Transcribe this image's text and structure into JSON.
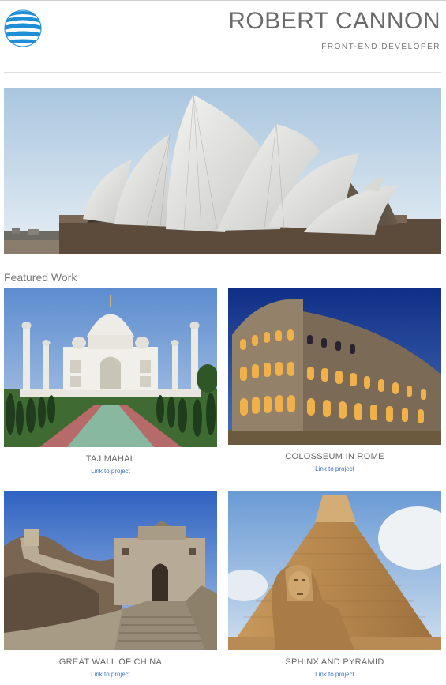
{
  "header": {
    "name": "ROBERT CANNON",
    "role": "FRONT-END DEVELOPER",
    "logo_icon": "globe-logo-icon"
  },
  "hero": {
    "image": "sydney-opera-house"
  },
  "featured": {
    "title": "Featured Work",
    "projects": [
      {
        "title": "TAJ MAHAL",
        "link": "Link to project",
        "image": "taj-mahal"
      },
      {
        "title": "COLOSSEUM IN ROME",
        "link": "Link to project",
        "image": "colosseum"
      },
      {
        "title": "GREAT WALL OF CHINA",
        "link": "Link to project",
        "image": "great-wall"
      },
      {
        "title": "SPHINX AND PYRAMID",
        "link": "Link to project",
        "image": "sphinx-pyramid"
      }
    ]
  },
  "colors": {
    "link": "#3d78c4",
    "logo": "#1e8fd6",
    "text": "#6a6a6a"
  }
}
